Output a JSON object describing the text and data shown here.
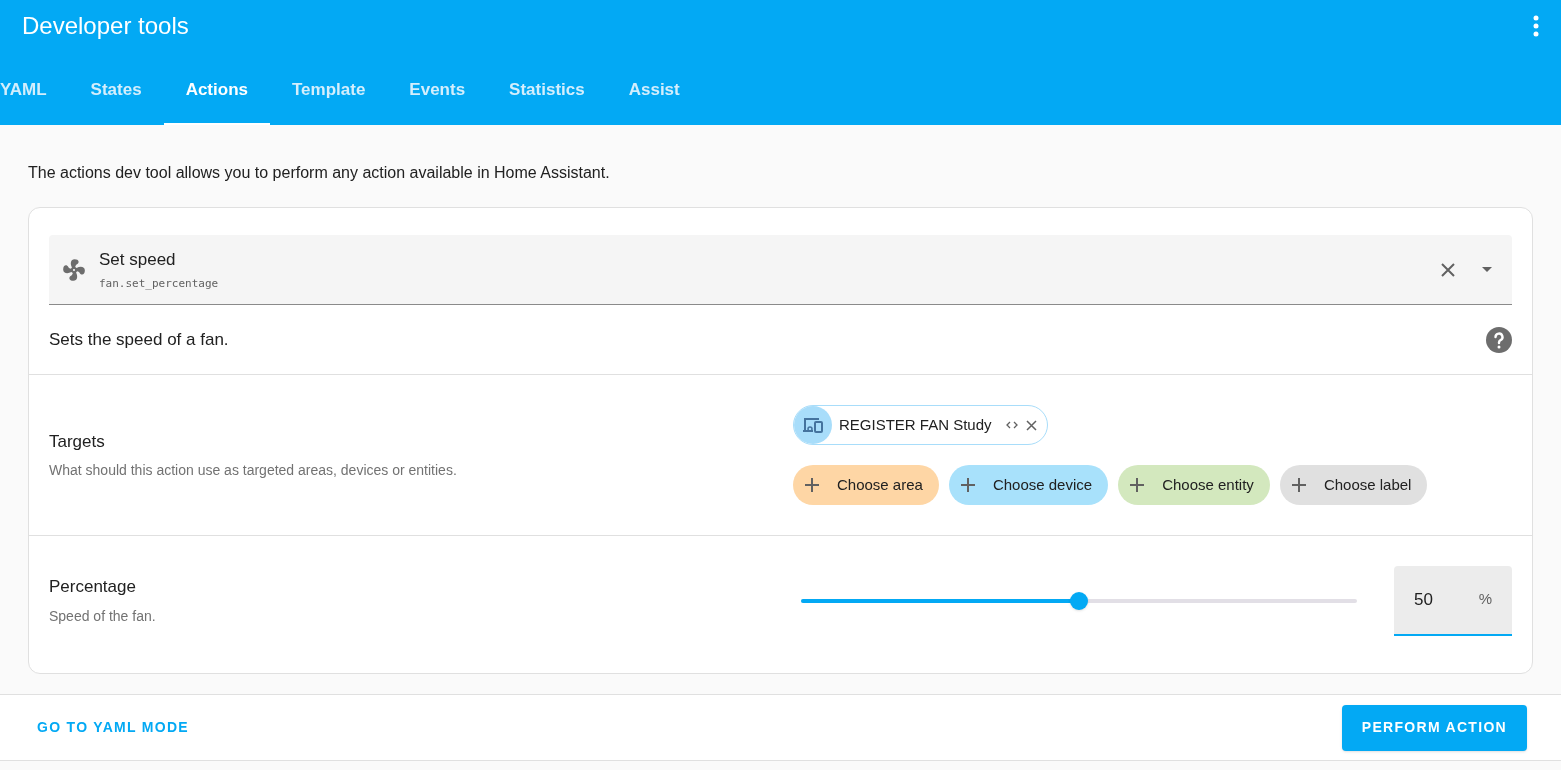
{
  "header": {
    "title": "Developer tools"
  },
  "tabs": [
    {
      "label": "YAML",
      "selected": false
    },
    {
      "label": "States",
      "selected": false
    },
    {
      "label": "Actions",
      "selected": true
    },
    {
      "label": "Template",
      "selected": false
    },
    {
      "label": "Events",
      "selected": false
    },
    {
      "label": "Statistics",
      "selected": false
    },
    {
      "label": "Assist",
      "selected": false
    }
  ],
  "intro": "The actions dev tool allows you to perform any action available in Home Assistant.",
  "action": {
    "name": "Set speed",
    "id": "fan.set_percentage",
    "description": "Sets the speed of a fan."
  },
  "targets": {
    "label": "Targets",
    "hint": "What should this action use as targeted areas, devices or entities.",
    "selected": [
      {
        "label": "REGISTER FAN Study",
        "color": "#a8ddfa"
      }
    ],
    "add_chips": [
      {
        "label": "Choose area",
        "color": "#fed6a5"
      },
      {
        "label": "Choose device",
        "color": "#a8e1fb"
      },
      {
        "label": "Choose entity",
        "color": "#d3e8be"
      },
      {
        "label": "Choose label",
        "color": "#e0e0e0"
      }
    ]
  },
  "percentage": {
    "label": "Percentage",
    "hint": "Speed of the fan.",
    "level": 0.5,
    "value": "50",
    "unit": "%"
  },
  "footer": {
    "yaml_link": "GO TO YAML MODE",
    "perform": "PERFORM ACTION"
  }
}
